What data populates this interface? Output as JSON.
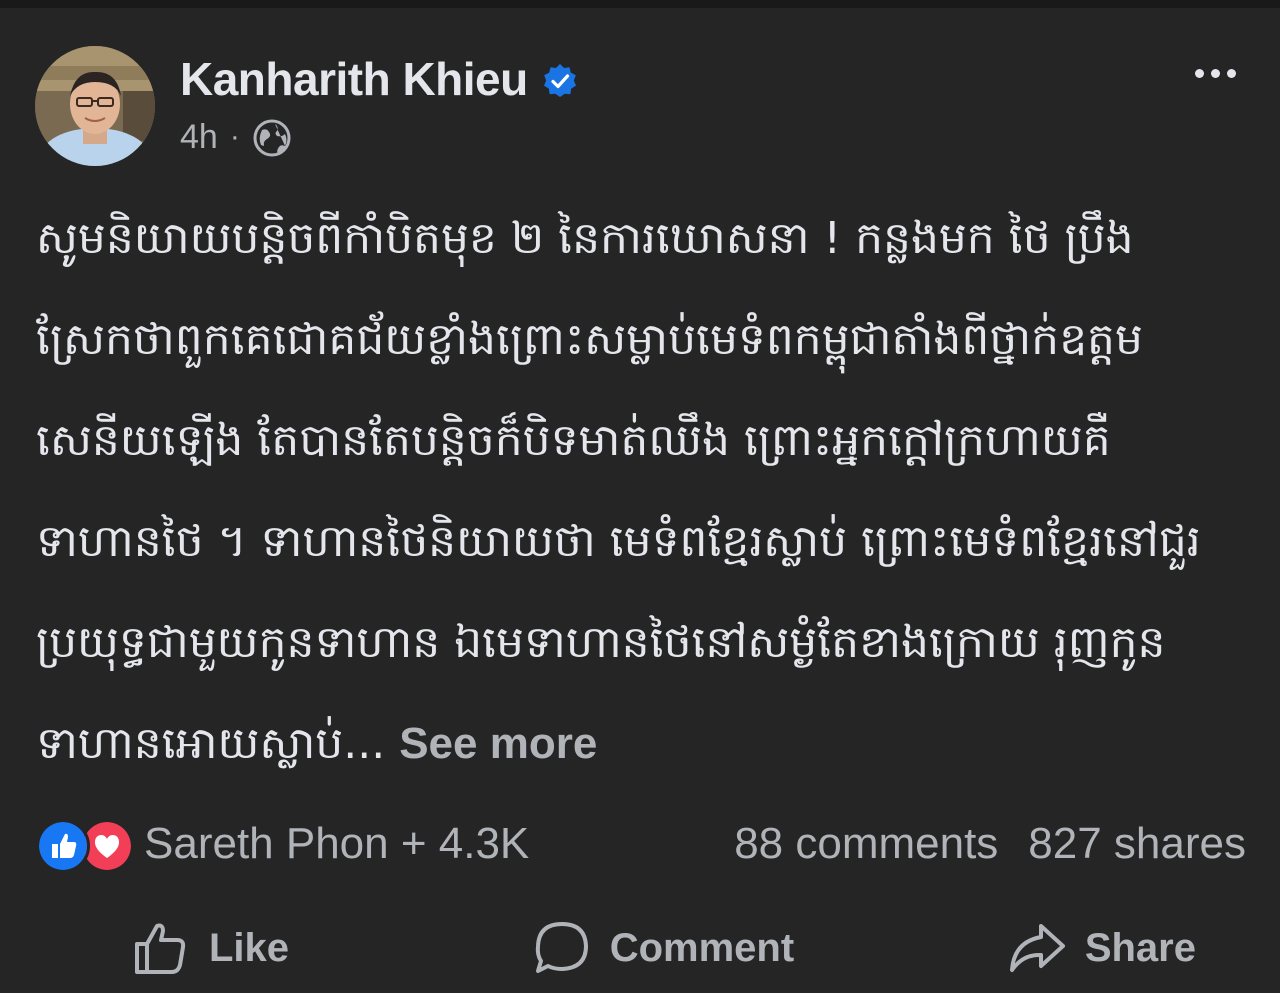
{
  "post": {
    "author_name": "Kanharith Khieu",
    "time": "4h",
    "separator": "·",
    "privacy_icon": "globe-icon",
    "verified_icon": "verified-badge-icon",
    "more_icon": "more-options-icon",
    "text": "សូមនិយាយបន្តិចពីកាំបិតមុខ ២ នៃការឃោសនា ! កន្លងមក ថៃ ប្រឹងស្រែកថាពួកគេជោគជ័យខ្លាំងព្រោះសម្លាប់មេទំពកម្ពុជាតាំងពីថ្នាក់ឧត្តមសេនីយឡើង តែបានតែបន្តិចក៏បិទមាត់ឈឹង ព្រោះអ្នកក្តៅក្រហាយគឺទាហានថៃ ។ ទាហានថៃនិយាយថា មេទំពខ្មែរស្លាប់ ព្រោះមេទំពខ្មែរនៅជួរប្រយុទ្ធជាមួយកូនទាហាន ឯមេទាហានថៃនៅសម្ងំតែខាងក្រោយ រុញកូនទាហានអោយស្លាប់...",
    "see_more": "See more"
  },
  "reactions": {
    "icons": [
      "like-reaction-icon",
      "love-reaction-icon"
    ],
    "summary": "Sareth Phon + 4.3K",
    "comments": "88 comments",
    "shares": "827 shares"
  },
  "actions": {
    "like_label": "Like",
    "comment_label": "Comment",
    "share_label": "Share"
  },
  "colors": {
    "background": "#252526",
    "text_primary": "#e4e6eb",
    "text_secondary": "#b0b3b8",
    "verified_blue": "#1b74e4",
    "like_blue": "#1877f2",
    "love_red": "#f33e58"
  }
}
